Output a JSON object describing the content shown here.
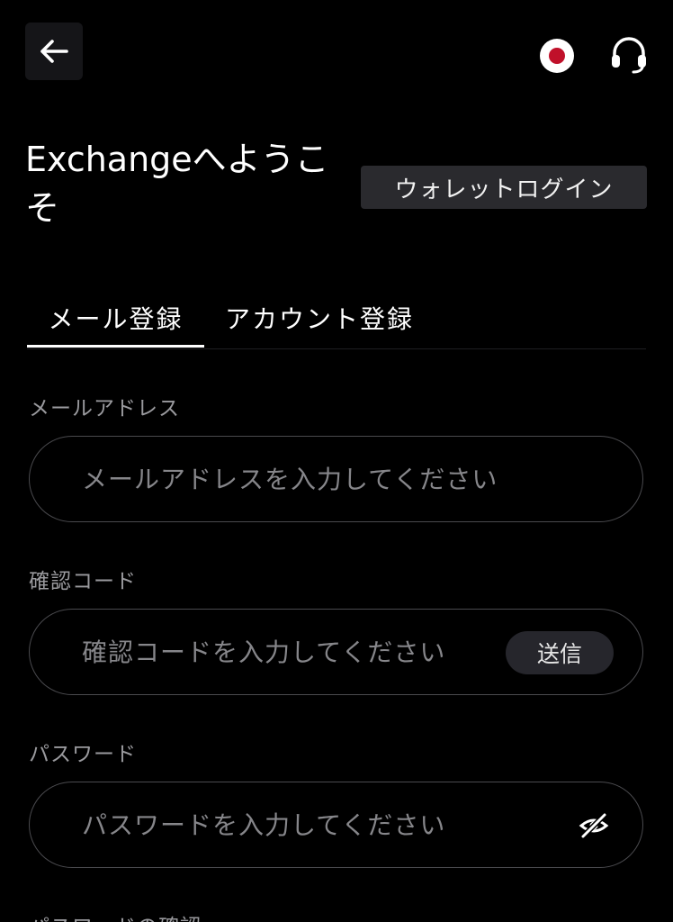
{
  "header": {
    "back_icon": "arrow-left-icon",
    "language_icon": "japan-flag-icon",
    "support_icon": "headset-icon"
  },
  "welcome": {
    "title": "Exchangeへようこそ",
    "wallet_login_label": "ウォレットログイン"
  },
  "tabs": [
    {
      "label": "メール登録",
      "active": true
    },
    {
      "label": "アカウント登録",
      "active": false
    }
  ],
  "form": {
    "email": {
      "label": "メールアドレス",
      "placeholder": "メールアドレスを入力してください",
      "value": ""
    },
    "code": {
      "label": "確認コード",
      "placeholder": "確認コードを入力してください",
      "value": "",
      "send_label": "送信"
    },
    "password": {
      "label": "パスワード",
      "placeholder": "パスワードを入力してください",
      "value": "",
      "toggle_icon": "eye-off-icon"
    },
    "password_confirm": {
      "label": "パスワードの確認"
    }
  },
  "colors": {
    "background": "#000000",
    "flag_red": "#c0102a",
    "field_border": "#4a4a4e"
  }
}
